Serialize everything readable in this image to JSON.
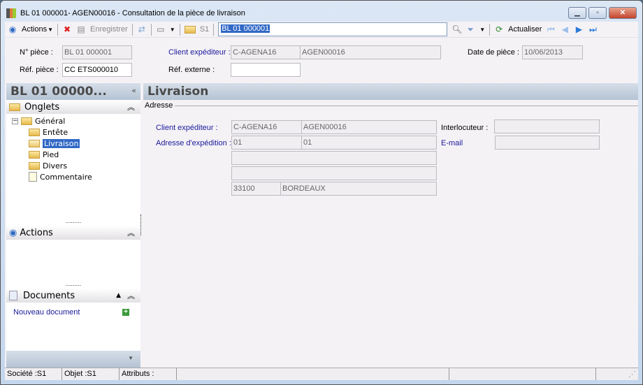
{
  "window": {
    "title": "BL 01 000001- AGEN00016 -  Consultation de la pièce de livraison"
  },
  "toolbar": {
    "actions": "Actions",
    "save": "Enregistrer",
    "folder": "S1",
    "search_value": "BL 01 000001",
    "refresh": "Actualiser"
  },
  "header": {
    "num_label": "N° pièce :",
    "num_value": "BL 01 000001",
    "ref_label": "Réf. pièce :",
    "ref_value": "CC ETS000010",
    "client_label": "Client expéditeur :",
    "client_code": "C-AGENA16",
    "client_name": "AGEN00016",
    "refext_label": "Réf. externe :",
    "refext_value": "",
    "date_label": "Date de pièce :",
    "date_value": "10/06/2013"
  },
  "left": {
    "title": "BL 01 00000...",
    "tabs_label": "Onglets",
    "tree": [
      {
        "label": "Général"
      },
      {
        "label": "Entête"
      },
      {
        "label": "Livraison"
      },
      {
        "label": "Pied"
      },
      {
        "label": "Divers"
      },
      {
        "label": "Commentaire"
      }
    ],
    "actions_label": "Actions",
    "documents_label": "Documents",
    "new_doc": "Nouveau document"
  },
  "main": {
    "title": "Livraison",
    "group": "Adresse",
    "client_label": "Client expéditeur :",
    "client_code": "C-AGENA16",
    "client_name": "AGEN00016",
    "addr_label": "Adresse d'expédition :",
    "addr_code": "01",
    "addr_name": "01",
    "addr1": "",
    "addr2": "",
    "zip": "33100",
    "city": "BORDEAUX",
    "contact_label": "Interlocuteur :",
    "contact_value": "",
    "email_label": "E-mail",
    "email_value": ""
  },
  "status": {
    "company": "Société :S1",
    "object": "Objet :S1",
    "attributes": "Attributs :"
  }
}
